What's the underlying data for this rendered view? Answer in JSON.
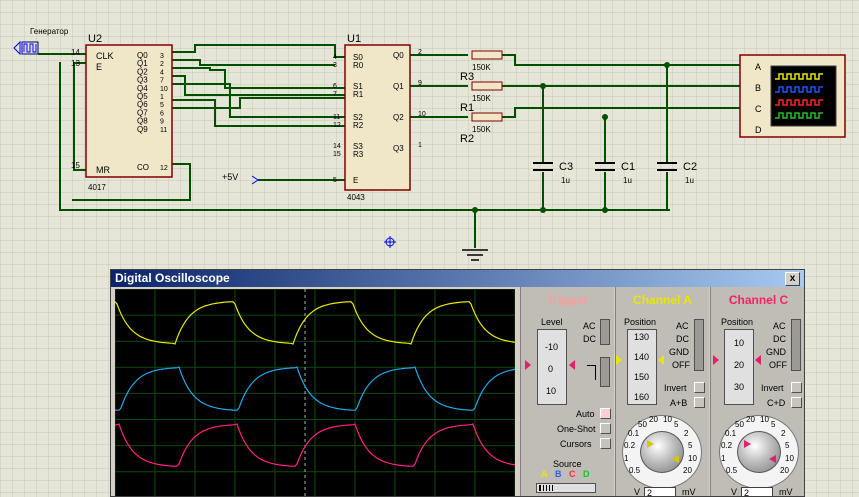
{
  "schematic": {
    "generator_label": "Генератор",
    "u2": {
      "ref": "U2",
      "part": "4017",
      "pins_left": [
        "CLK",
        "E",
        "MR"
      ],
      "pins_left_nums": [
        "14",
        "13",
        "15"
      ],
      "pins_right": [
        "Q0",
        "Q1",
        "Q2",
        "Q3",
        "Q4",
        "Q5",
        "Q6",
        "Q7",
        "Q8",
        "Q9",
        "CO"
      ],
      "pins_right_nums": [
        "3",
        "2",
        "4",
        "7",
        "10",
        "1",
        "5",
        "6",
        "9",
        "11",
        "12"
      ]
    },
    "u1": {
      "ref": "U1",
      "part": "4043",
      "pins_left": [
        "S0",
        "R0",
        "S1",
        "R1",
        "S2",
        "R2",
        "S3",
        "R3",
        "E"
      ],
      "pins_left_nums": [
        "4",
        "3",
        "6",
        "7",
        "11",
        "12",
        "14",
        "15",
        "5"
      ],
      "pins_right": [
        "Q0",
        "Q1",
        "Q2",
        "Q3"
      ],
      "pins_right_nums": [
        "2",
        "9",
        "10",
        "1"
      ]
    },
    "resistors": [
      {
        "ref": "R3",
        "value": "150K"
      },
      {
        "ref": "R1",
        "value": "150K"
      },
      {
        "ref": "R2",
        "value": "150K"
      }
    ],
    "top_resistor_value": "150K",
    "capacitors": [
      {
        "ref": "C3",
        "value": "1u"
      },
      {
        "ref": "C1",
        "value": "1u"
      },
      {
        "ref": "C2",
        "value": "1u"
      }
    ],
    "supply_label": "+5V",
    "scope_channels": [
      "A",
      "B",
      "C",
      "D"
    ]
  },
  "oscilloscope": {
    "title": "Digital Oscilloscope",
    "close_label": "x",
    "trigger": {
      "title": "Trigger",
      "level_label": "Level",
      "level_ticks": [
        "-10",
        "0",
        "10"
      ],
      "ac_label": "AC",
      "dc_label": "DC",
      "auto_label": "Auto",
      "oneshot_label": "One-Shot",
      "cursors_label": "Cursors",
      "source_label": "Source",
      "source_channels": [
        "A",
        "B",
        "C",
        "D"
      ],
      "source_colors": [
        "#e8e800",
        "#2060ff",
        "#ff3030",
        "#20c020"
      ]
    },
    "channel_a": {
      "title": "Channel A",
      "position_label": "Position",
      "position_ticks": [
        "130",
        "140",
        "150",
        "160"
      ],
      "modes": [
        "AC",
        "DC",
        "GND",
        "OFF"
      ],
      "invert_label": "Invert",
      "combine_label": "A+B",
      "dial_ticks": [
        "0.5",
        "1",
        "0.2",
        "0.1",
        "50",
        "20",
        "10",
        "5",
        "2",
        "5",
        "10",
        "20"
      ],
      "unit_left": "V",
      "unit_right": "mV",
      "value": "2"
    },
    "channel_c": {
      "title": "Channel C",
      "position_label": "Position",
      "position_ticks": [
        "10",
        "20",
        "30"
      ],
      "modes": [
        "AC",
        "DC",
        "GND",
        "OFF"
      ],
      "invert_label": "Invert",
      "combine_label": "C+D",
      "dial_ticks": [
        "0.5",
        "1",
        "0.2",
        "0.1",
        "50",
        "20",
        "10",
        "5",
        "2",
        "5",
        "10",
        "20"
      ],
      "unit_left": "V",
      "unit_right": "mV",
      "value": "2"
    },
    "traces": [
      {
        "channel": "A",
        "color": "#e8e800"
      },
      {
        "channel": "B",
        "color": "#20a8e8"
      },
      {
        "channel": "C",
        "color": "#ff2080"
      }
    ]
  }
}
